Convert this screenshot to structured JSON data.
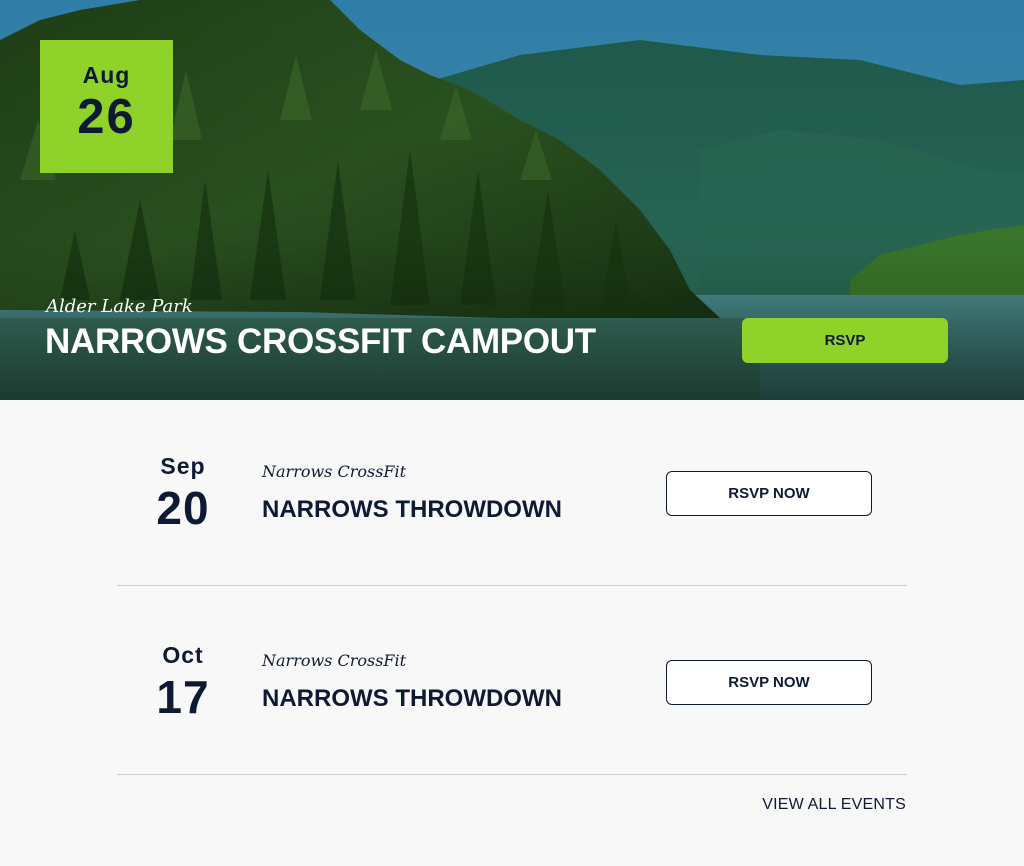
{
  "featured": {
    "month": "Aug",
    "day": "26",
    "venue": "Alder Lake Park",
    "title": "NARROWS CROSSFIT CAMPOUT",
    "rsvp_label": "RSVP"
  },
  "events": [
    {
      "month": "Sep",
      "day": "20",
      "venue": "Narrows CrossFit",
      "title": "NARROWS THROWDOWN",
      "rsvp_label": "RSVP NOW"
    },
    {
      "month": "Oct",
      "day": "17",
      "venue": "Narrows CrossFit",
      "title": "NARROWS THROWDOWN",
      "rsvp_label": "RSVP NOW"
    }
  ],
  "view_all_label": "VIEW ALL EVENTS",
  "colors": {
    "accent": "#8fd32a",
    "text": "#0e1a33",
    "background": "#f8f8f8"
  }
}
